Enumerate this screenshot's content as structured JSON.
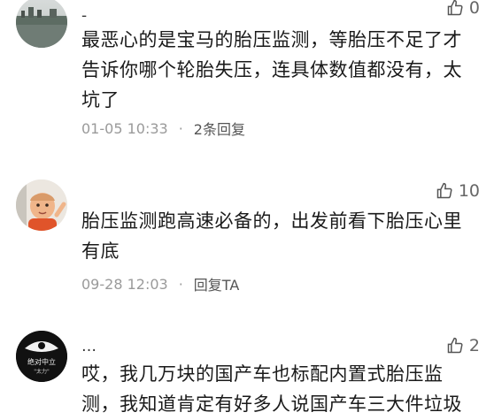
{
  "comments": [
    {
      "name": "-",
      "likes": "0",
      "text": "最恶心的是宝马的胎压监测，等胎压不足了才告诉你哪个轮胎失压，连具体数值都没有，太坑了",
      "time": "01-05 10:33",
      "reply": "2条回复"
    },
    {
      "name": "",
      "likes": "10",
      "text": "胎压监测跑高速必备的，出发前看下胎压心里有底",
      "time": "09-28 12:03",
      "reply": "回复TA"
    },
    {
      "name": "…",
      "likes": "2",
      "text": "哎，我几万块的国产车也标配内置式胎压监测，我知道肯定有好多人说国产车三大件垃圾",
      "avatar_badge": "绝对中立",
      "avatar_badge_sub": "\"太力\""
    }
  ],
  "colors": {
    "meta": "#9a9a9a",
    "text": "#1a1a1a"
  },
  "icons": {
    "like": "thumbs-up-icon"
  }
}
